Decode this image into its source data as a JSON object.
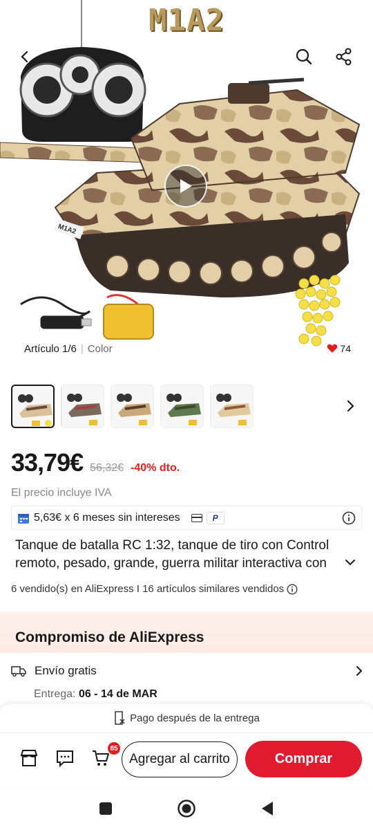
{
  "hero": {
    "model_title": "M1A2",
    "tank_label": "M1A2",
    "article_label": "Artículo 1/6",
    "color_label": "Color",
    "likes": "74"
  },
  "price": {
    "current": "33,79€",
    "original": "56,32€",
    "discount": "-40% dto.",
    "vat_note": "El precio incluye IVA"
  },
  "installments": {
    "text": "5,63€ x 6 meses sin intereses",
    "paypal_mark": "P"
  },
  "product": {
    "title_line1": "Tanque de batalla RC 1:32, tanque de tiro con Control",
    "title_line2": "remoto, pesado, grande, guerra militar interactiva con",
    "sold_info": "6 vendido(s) en AliExpress I 16 artículos similares vendidos"
  },
  "commitment": {
    "title": "Compromiso de AliExpress",
    "shipping": "Envío gratis",
    "delivery_label": "Entrega:",
    "delivery_dates": "06 - 14 de MAR"
  },
  "bottom_bar": {
    "pay_after": "Pago después de la entrega",
    "cart_count": "85",
    "add_to_cart": "Agregar al carrito",
    "buy": "Comprar"
  },
  "colors": {
    "accent_red": "#e01b2f",
    "discount_red": "#e02020",
    "commitment_bg": "#fdf1ec"
  },
  "icons": [
    "back-icon",
    "search-icon",
    "share-icon",
    "play-icon",
    "heart-icon",
    "chevron-right-icon",
    "calendar-icon",
    "card-icon",
    "info-icon",
    "chevron-down-icon",
    "truck-icon",
    "receipt-icon",
    "store-icon",
    "message-icon",
    "cart-icon"
  ]
}
